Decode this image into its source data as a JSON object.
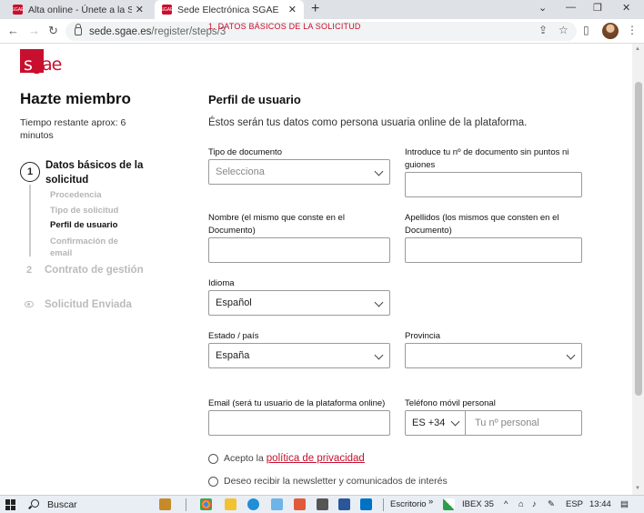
{
  "browser": {
    "tabs": [
      {
        "title": "Alta online - Únete a la SGAE",
        "favicon": "SGAE"
      },
      {
        "title": "Sede Electrónica SGAE",
        "favicon": "SGAE"
      }
    ],
    "new_tab": "+",
    "window_controls": [
      "⌄",
      "—",
      "❐",
      "✕"
    ],
    "url_host": "sede.sgae.es",
    "url_path": "/register/steps/3"
  },
  "logo": {
    "text_a": "s",
    "text_b": "gae",
    "alt": "sgae"
  },
  "sidebar": {
    "title": "Hazte miembro",
    "time_remaining": "Tiempo restante aprox: 6 minutos",
    "step1": {
      "number": "1",
      "label": "Datos básicos de la solicitud"
    },
    "substeps": [
      "Procedencia",
      "Tipo de solicitud",
      "Perfil de usuario",
      "Confirmación de email"
    ],
    "current_substep_index": 2,
    "step2": {
      "number": "2",
      "label": "Contrato de gestión"
    },
    "step3": {
      "label": "Solicitud Enviada"
    }
  },
  "form": {
    "section_label": "1. DATOS BÁSICOS DE LA SOLICITUD",
    "title": "Perfil de usuario",
    "description": "Éstos serán tus datos como persona usuaria online de la plataforma.",
    "doc_type": {
      "label": "Tipo de documento",
      "value": "Selecciona"
    },
    "doc_number": {
      "label": "Introduce tu nº de documento sin puntos ni guiones",
      "value": ""
    },
    "name": {
      "label": "Nombre (el mismo que conste en el Documento)",
      "value": ""
    },
    "surname": {
      "label": "Apellidos (los mismos que consten en el Documento)",
      "value": ""
    },
    "language": {
      "label": "Idioma",
      "value": "Español"
    },
    "country": {
      "label": "Estado / país",
      "value": "España"
    },
    "province": {
      "label": "Provincia",
      "value": ""
    },
    "email": {
      "label": "Email (será tu usuario de la plataforma online)",
      "value": ""
    },
    "phone": {
      "label": "Teléfono móvil personal",
      "prefix": "ES +34",
      "placeholder": "Tu nº personal"
    },
    "privacy": {
      "text": "Acepto la",
      "link": "política de privacidad"
    },
    "newsletter": {
      "text": "Deseo recibir la newsletter y comunicados de interés"
    }
  },
  "taskbar": {
    "search": "Buscar",
    "folder_label": "Escritorio",
    "chevrons": "»",
    "ticker": "IBEX 35",
    "lang": "ESP",
    "time": "13:44"
  },
  "colors": {
    "brand": "#c8102e"
  }
}
